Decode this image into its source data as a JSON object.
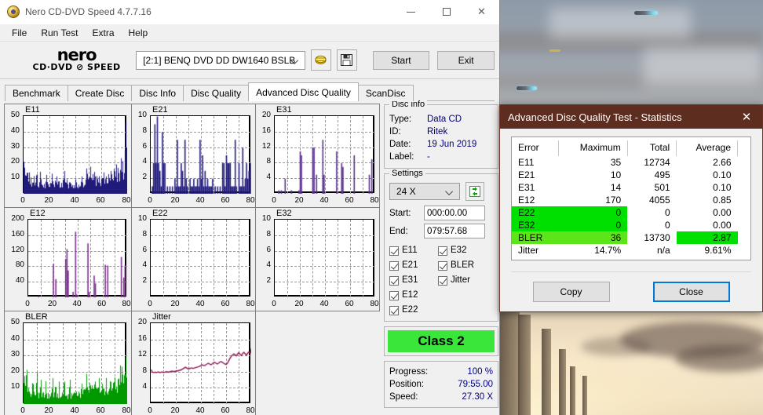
{
  "window": {
    "title": "Nero CD-DVD Speed 4.7.7.16",
    "icon": "nero-disc-icon",
    "minimize": "minimize-icon",
    "maximize": "maximize-icon",
    "close": "close-icon"
  },
  "menu": {
    "items": [
      "File",
      "Run Test",
      "Extra",
      "Help"
    ]
  },
  "logo": {
    "line1": "nero",
    "line2": "CD·DVD ⊘ SPEED"
  },
  "toolbar": {
    "drive": "[2:1]   BENQ DVD DD DW1640 BSLB",
    "eject_icon": "eject-disc-icon",
    "save_icon": "save-floppy-icon",
    "start_label": "Start",
    "exit_label": "Exit"
  },
  "tabs": {
    "items": [
      "Benchmark",
      "Create Disc",
      "Disc Info",
      "Disc Quality",
      "Advanced Disc Quality",
      "ScanDisc"
    ],
    "active": "Advanced Disc Quality"
  },
  "disc_info": {
    "legend": "Disc info",
    "rows": [
      {
        "key": "Type:",
        "value": "Data CD"
      },
      {
        "key": "ID:",
        "value": "Ritek"
      },
      {
        "key": "Date:",
        "value": "19 Jun 2019"
      },
      {
        "key": "Label:",
        "value": "-"
      }
    ]
  },
  "settings": {
    "legend": "Settings",
    "speed": "24 X",
    "refresh_icon": "refresh-icon",
    "start_label": "Start:",
    "start_value": "000:00.00",
    "end_label": "End:",
    "end_value": "079:57.68",
    "checkboxes_left": [
      "E11",
      "E21",
      "E31",
      "E12",
      "E22"
    ],
    "checkboxes_right": [
      "E32",
      "BLER",
      "Jitter"
    ]
  },
  "class_badge": "Class 2",
  "progress": {
    "rows": [
      {
        "key": "Progress:",
        "value": "100 %"
      },
      {
        "key": "Position:",
        "value": "79:55.00"
      },
      {
        "key": "Speed:",
        "value": "27.30 X"
      }
    ]
  },
  "stats_dialog": {
    "title": "Advanced Disc Quality Test - Statistics",
    "close_icon": "close-icon",
    "headers": [
      "Error",
      "Maximum",
      "Total",
      "Average"
    ],
    "rows": [
      {
        "error": "E11",
        "maximum": "35",
        "total": "12734",
        "average": "2.66",
        "highlight": "none"
      },
      {
        "error": "E21",
        "maximum": "10",
        "total": "495",
        "average": "0.10",
        "highlight": "none"
      },
      {
        "error": "E31",
        "maximum": "14",
        "total": "501",
        "average": "0.10",
        "highlight": "none"
      },
      {
        "error": "E12",
        "maximum": "170",
        "total": "4055",
        "average": "0.85",
        "highlight": "none"
      },
      {
        "error": "E22",
        "maximum": "0",
        "total": "0",
        "average": "0.00",
        "highlight": "green"
      },
      {
        "error": "E32",
        "maximum": "0",
        "total": "0",
        "average": "0.00",
        "highlight": "green"
      },
      {
        "error": "BLER",
        "maximum": "36",
        "total": "13730",
        "average": "2.87",
        "highlight": "bler"
      },
      {
        "error": "Jitter",
        "maximum": "14.7%",
        "total": "n/a",
        "average": "9.61%",
        "highlight": "none"
      }
    ],
    "copy_label": "Copy",
    "close_label": "Close"
  },
  "colors": {
    "e_series": "#201a7a",
    "e12_series": "#7b2d8e",
    "bler_series": "#009900",
    "jitter_series": "#8e1050",
    "dialog_title_bg": "#5d2e20",
    "class_green": "#39e639",
    "highlight_green": "#00e000",
    "highlight_bler": "#5ce619",
    "value_blue": "#000080"
  },
  "chart_data": [
    {
      "type": "area",
      "name": "E11",
      "title": "E11",
      "xlabel": "",
      "ylabel": "",
      "xlim": [
        0,
        80
      ],
      "ylim": [
        0,
        50
      ],
      "xticks": [
        0,
        20,
        40,
        60,
        80
      ],
      "yticks": [
        10,
        20,
        30,
        40,
        50
      ],
      "grid": true,
      "color": "#201a7a",
      "baseline": [
        11,
        10,
        9,
        9,
        8,
        8,
        8,
        7,
        7,
        6,
        6,
        6,
        6,
        5,
        5,
        6,
        6,
        6,
        6,
        6,
        6,
        6,
        6,
        7,
        7,
        7,
        7,
        7,
        7,
        7,
        7,
        7,
        7,
        6,
        6,
        6,
        6,
        6,
        6,
        6,
        6,
        6,
        6,
        6,
        7,
        7,
        7,
        8,
        8,
        9,
        9,
        9,
        10,
        10,
        9,
        9,
        9,
        9,
        9,
        9,
        8,
        8,
        8,
        8,
        8,
        9,
        9,
        10,
        10,
        10,
        11,
        11,
        12,
        12,
        13,
        14,
        15,
        16,
        18,
        19
      ],
      "peaks": [
        [
          0,
          19
        ],
        [
          1,
          14
        ],
        [
          2,
          16
        ],
        [
          4,
          13
        ],
        [
          7,
          12
        ],
        [
          10,
          13
        ],
        [
          13,
          12
        ],
        [
          17,
          11
        ],
        [
          22,
          12
        ],
        [
          27,
          11
        ],
        [
          31,
          12
        ],
        [
          35,
          11
        ],
        [
          40,
          11
        ],
        [
          44,
          12
        ],
        [
          48,
          13
        ],
        [
          51,
          14
        ],
        [
          54,
          13
        ],
        [
          57,
          12
        ],
        [
          60,
          11
        ],
        [
          63,
          12
        ],
        [
          66,
          12
        ],
        [
          69,
          13
        ],
        [
          72,
          15
        ],
        [
          74,
          21
        ],
        [
          75,
          25
        ],
        [
          77,
          22
        ],
        [
          78,
          28
        ],
        [
          79,
          35
        ]
      ],
      "max": 35,
      "total": 12734,
      "average": 2.66
    },
    {
      "type": "bar",
      "name": "E21",
      "title": "E21",
      "xlim": [
        0,
        80
      ],
      "ylim": [
        0,
        10
      ],
      "xticks": [
        0,
        20,
        40,
        60,
        80
      ],
      "yticks": [
        2,
        4,
        6,
        8,
        10
      ],
      "grid": true,
      "color": "#201a7a",
      "bars": [
        [
          1,
          1
        ],
        [
          2,
          4
        ],
        [
          3,
          9
        ],
        [
          4,
          4
        ],
        [
          5,
          10
        ],
        [
          6,
          4
        ],
        [
          7,
          3
        ],
        [
          8,
          1
        ],
        [
          9,
          8
        ],
        [
          10,
          4
        ],
        [
          11,
          4
        ],
        [
          13,
          1
        ],
        [
          15,
          1
        ],
        [
          17,
          1
        ],
        [
          19,
          2
        ],
        [
          20,
          1
        ],
        [
          21,
          7
        ],
        [
          22,
          1
        ],
        [
          23,
          1
        ],
        [
          24,
          4
        ],
        [
          25,
          3
        ],
        [
          26,
          1
        ],
        [
          27,
          7
        ],
        [
          28,
          2
        ],
        [
          29,
          1
        ],
        [
          31,
          2
        ],
        [
          32,
          1
        ],
        [
          33,
          1
        ],
        [
          34,
          2
        ],
        [
          35,
          1
        ],
        [
          36,
          1
        ],
        [
          37,
          2
        ],
        [
          38,
          1
        ],
        [
          39,
          7
        ],
        [
          40,
          2
        ],
        [
          41,
          5
        ],
        [
          42,
          1
        ],
        [
          43,
          3
        ],
        [
          44,
          1
        ],
        [
          45,
          2
        ],
        [
          46,
          1
        ],
        [
          47,
          1
        ],
        [
          48,
          1
        ],
        [
          49,
          2
        ],
        [
          51,
          1
        ],
        [
          53,
          1
        ],
        [
          55,
          1
        ],
        [
          57,
          4
        ],
        [
          58,
          4
        ],
        [
          59,
          1
        ],
        [
          60,
          5
        ],
        [
          61,
          4
        ],
        [
          62,
          4
        ],
        [
          63,
          4
        ],
        [
          64,
          1
        ],
        [
          65,
          1
        ],
        [
          66,
          1
        ],
        [
          67,
          7
        ],
        [
          68,
          1
        ],
        [
          70,
          4
        ],
        [
          71,
          1
        ],
        [
          72,
          1
        ],
        [
          73,
          6
        ],
        [
          74,
          1
        ],
        [
          75,
          2
        ],
        [
          76,
          4
        ],
        [
          77,
          2
        ],
        [
          78,
          3
        ],
        [
          79,
          4
        ]
      ],
      "max": 10,
      "total": 495,
      "average": 0.1
    },
    {
      "type": "bar",
      "name": "E31",
      "title": "E31",
      "xlim": [
        0,
        80
      ],
      "ylim": [
        0,
        20
      ],
      "xticks": [
        0,
        20,
        40,
        60,
        80
      ],
      "yticks": [
        4,
        8,
        12,
        16,
        20
      ],
      "grid": true,
      "color": "#5a2f8f",
      "bars": [
        [
          3,
          1
        ],
        [
          5,
          1
        ],
        [
          8,
          4
        ],
        [
          13,
          1
        ],
        [
          19,
          1
        ],
        [
          20,
          11
        ],
        [
          21,
          10
        ],
        [
          30,
          12
        ],
        [
          31,
          12
        ],
        [
          33,
          5
        ],
        [
          38,
          14
        ],
        [
          39,
          5
        ],
        [
          49,
          11
        ],
        [
          53,
          8
        ],
        [
          54,
          7
        ],
        [
          63,
          10
        ],
        [
          75,
          5
        ],
        [
          77,
          9
        ]
      ],
      "max": 14,
      "total": 501,
      "average": 0.1
    },
    {
      "type": "bar",
      "name": "E12",
      "title": "E12",
      "xlim": [
        0,
        80
      ],
      "ylim": [
        0,
        200
      ],
      "xticks": [
        0,
        20,
        40,
        60,
        80
      ],
      "yticks": [
        40,
        80,
        120,
        160,
        200
      ],
      "grid": true,
      "color": "#7b2d8e",
      "bars": [
        [
          8,
          5
        ],
        [
          20,
          87
        ],
        [
          22,
          48
        ],
        [
          30,
          100
        ],
        [
          31,
          125
        ],
        [
          32,
          70
        ],
        [
          36,
          15
        ],
        [
          38,
          170
        ],
        [
          39,
          8
        ],
        [
          48,
          140
        ],
        [
          49,
          15
        ],
        [
          53,
          57
        ],
        [
          54,
          37
        ],
        [
          62,
          85
        ],
        [
          64,
          83
        ],
        [
          75,
          105
        ],
        [
          77,
          52
        ],
        [
          78,
          83
        ]
      ],
      "max": 170,
      "total": 4055,
      "average": 0.85
    },
    {
      "type": "bar",
      "name": "E22",
      "title": "E22",
      "xlim": [
        0,
        80
      ],
      "ylim": [
        0,
        10
      ],
      "xticks": [
        0,
        20,
        40,
        60,
        80
      ],
      "yticks": [
        2,
        4,
        6,
        8,
        10
      ],
      "grid": true,
      "color": "#201a7a",
      "bars": [],
      "max": 0,
      "total": 0,
      "average": 0.0
    },
    {
      "type": "bar",
      "name": "E32",
      "title": "E32",
      "xlim": [
        0,
        80
      ],
      "ylim": [
        0,
        10
      ],
      "xticks": [
        0,
        20,
        40,
        60,
        80
      ],
      "yticks": [
        2,
        4,
        6,
        8,
        10
      ],
      "grid": true,
      "color": "#201a7a",
      "bars": [],
      "max": 0,
      "total": 0,
      "average": 0.0
    },
    {
      "type": "area",
      "name": "BLER",
      "title": "BLER",
      "xlim": [
        0,
        80
      ],
      "ylim": [
        0,
        50
      ],
      "xticks": [
        0,
        20,
        40,
        60,
        80
      ],
      "yticks": [
        10,
        20,
        30,
        40,
        50
      ],
      "grid": true,
      "color": "#009900",
      "baseline": [
        12,
        11,
        10,
        9,
        9,
        8,
        8,
        8,
        7,
        7,
        6,
        6,
        6,
        6,
        6,
        6,
        6,
        6,
        6,
        6,
        6,
        7,
        7,
        7,
        7,
        7,
        7,
        7,
        7,
        7,
        7,
        7,
        7,
        6,
        6,
        6,
        6,
        6,
        6,
        6,
        6,
        6,
        7,
        7,
        7,
        8,
        8,
        9,
        9,
        10,
        10,
        10,
        10,
        10,
        10,
        9,
        9,
        9,
        9,
        9,
        9,
        9,
        9,
        9,
        9,
        9,
        10,
        10,
        11,
        11,
        11,
        12,
        12,
        13,
        14,
        15,
        16,
        17,
        18,
        20
      ],
      "peaks": [
        [
          0,
          20
        ],
        [
          1,
          15
        ],
        [
          2,
          17
        ],
        [
          4,
          14
        ],
        [
          7,
          13
        ],
        [
          10,
          14
        ],
        [
          13,
          13
        ],
        [
          17,
          12
        ],
        [
          22,
          13
        ],
        [
          27,
          12
        ],
        [
          31,
          13
        ],
        [
          35,
          12
        ],
        [
          40,
          12
        ],
        [
          44,
          13
        ],
        [
          48,
          14
        ],
        [
          51,
          15
        ],
        [
          54,
          14
        ],
        [
          57,
          13
        ],
        [
          60,
          12
        ],
        [
          63,
          13
        ],
        [
          66,
          13
        ],
        [
          69,
          14
        ],
        [
          72,
          16
        ],
        [
          74,
          22
        ],
        [
          75,
          26
        ],
        [
          77,
          23
        ],
        [
          78,
          20
        ],
        [
          79,
          23
        ]
      ],
      "max": 36,
      "total": 13730,
      "average": 2.87
    },
    {
      "type": "line",
      "name": "Jitter",
      "title": "Jitter",
      "xlim": [
        0,
        80
      ],
      "ylim": [
        0,
        20
      ],
      "xticks": [
        0,
        20,
        40,
        60,
        80
      ],
      "yticks": [
        4,
        8,
        12,
        16,
        20
      ],
      "grid": true,
      "color": "#8e1050",
      "values": [
        8.6,
        8.0,
        7.9,
        8.0,
        7.9,
        8.0,
        8.0,
        7.9,
        8.0,
        8.0,
        7.9,
        8.0,
        8.1,
        8.0,
        8.0,
        8.1,
        8.2,
        8.2,
        8.1,
        8.2,
        8.3,
        8.3,
        8.4,
        8.5,
        8.6,
        8.8,
        9.0,
        9.2,
        9.0,
        8.8,
        8.8,
        9.0,
        9.0,
        8.9,
        9.0,
        9.1,
        9.2,
        9.3,
        9.4,
        9.6,
        9.8,
        9.7,
        9.6,
        9.8,
        10.0,
        10.2,
        10.0,
        9.8,
        10.0,
        10.3,
        10.4,
        10.2,
        10.0,
        10.2,
        10.5,
        10.6,
        10.4,
        10.2,
        10.0,
        9.9,
        10.2,
        10.8,
        11.4,
        11.9,
        12.2,
        12.5,
        12.3,
        12.0,
        12.5,
        12.8,
        12.4,
        12.1,
        12.6,
        12.9,
        12.5,
        12.2,
        12.7,
        13.0,
        12.6,
        14.0
      ],
      "max": "14.7%",
      "average": "9.61%"
    }
  ]
}
